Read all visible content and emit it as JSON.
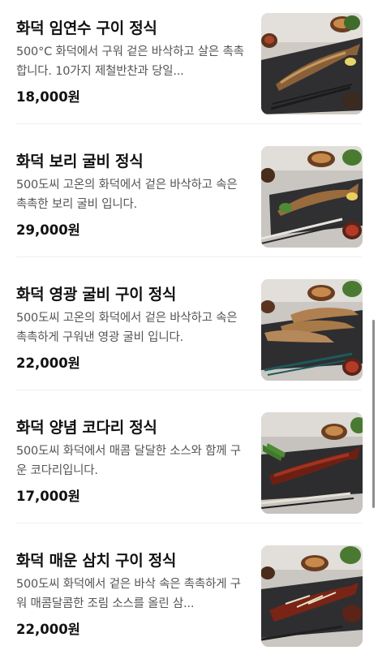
{
  "menu": {
    "items": [
      {
        "name": "화덕 임연수 구이 정식",
        "description": "500°C 화덕에서 구워 겉은 바삭하고 살은 촉촉합니다. 10가지 제철반찬과 당일...",
        "price": "18,000원",
        "image_icon": "grilled-atka-mackerel-set-photo"
      },
      {
        "name": "화덕 보리 굴비 정식",
        "description": "500도씨 고온의 화덕에서 겉은 바삭하고 속은 촉촉한 보리 굴비 입니다.",
        "price": "29,000원",
        "image_icon": "barley-dried-croaker-set-photo"
      },
      {
        "name": "화덕 영광 굴비 구이 정식",
        "description": "500도씨 고온의 화덕에서 겉은 바삭하고 속은 촉촉하게 구워낸 영광 굴비 입니다.",
        "price": "22,000원",
        "image_icon": "yeonggwang-croaker-set-photo"
      },
      {
        "name": "화덕 양념 코다리 정식",
        "description": "500도씨 화덕에서 매콤 달달한 소스와 함께 구운 코다리입니다.",
        "price": "17,000원",
        "image_icon": "seasoned-pollock-set-photo"
      },
      {
        "name": "화덕 매운 삼치 구이 정식",
        "description": "500도씨 화덕에서 겉은 바삭 속은 촉촉하게 구워 매콤달콤한 조림 소스를 올린 삼...",
        "price": "22,000원",
        "image_icon": "spicy-spanish-mackerel-set-photo"
      }
    ]
  }
}
